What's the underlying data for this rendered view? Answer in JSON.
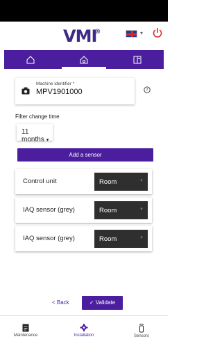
{
  "header": {
    "logo": "VMI",
    "logo_mark": "®",
    "language_flag": "gb-flag-icon"
  },
  "tabs": [
    {
      "icon": "house-outline-icon",
      "active": false
    },
    {
      "icon": "house-gear-icon",
      "active": true
    },
    {
      "icon": "building-icon",
      "active": false
    }
  ],
  "machine": {
    "label": "Machine identifier *",
    "value": "MPV1901000"
  },
  "filter": {
    "label": "Filter change time",
    "value": "11 months"
  },
  "add_sensor_label": "Add a sensor",
  "sensors": [
    {
      "name": "Control unit",
      "value": "Room"
    },
    {
      "name": "IAQ sensor (grey)",
      "value": "Room"
    },
    {
      "name": "IAQ sensor (grey)",
      "value": "Room"
    }
  ],
  "actions": {
    "back_label": "< Back",
    "validate_label": "Validate"
  },
  "bottom_nav": [
    {
      "label": "Maintenance",
      "icon": "clipboard-icon",
      "active": false
    },
    {
      "label": "Installation",
      "icon": "gear-icon",
      "active": true
    },
    {
      "label": "Sensors",
      "icon": "sensor-icon",
      "active": false
    }
  ],
  "colors": {
    "primary": "#4a1e9e",
    "select_bg": "#2f2f2f"
  }
}
